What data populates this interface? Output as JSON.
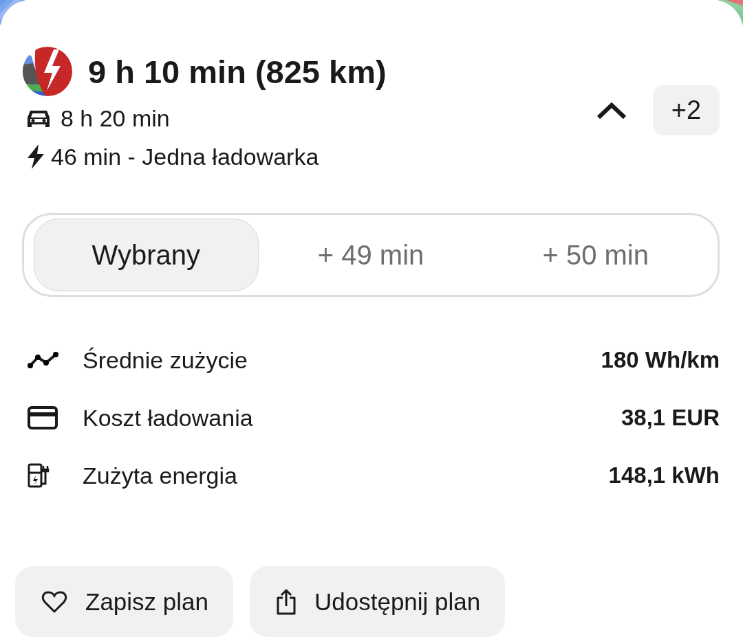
{
  "route": {
    "total": "9 h 10 min (825 km)",
    "drive_time": "8 h 20 min",
    "charging": "46 min - Jedna ładowarka",
    "expanded": true,
    "more_count": "+2"
  },
  "alternatives": [
    {
      "label": "Wybrany",
      "selected": true
    },
    {
      "label": "+ 49 min",
      "selected": false
    },
    {
      "label": "+ 50 min",
      "selected": false
    }
  ],
  "stats": [
    {
      "kind": "consumption",
      "label": "Średnie zużycie",
      "value": "180 Wh/km"
    },
    {
      "kind": "cost",
      "label": "Koszt ładowania",
      "value": "38,1 EUR"
    },
    {
      "kind": "energy",
      "label": "Zużyta energia",
      "value": "148,1 kWh"
    }
  ],
  "actions": [
    {
      "kind": "save",
      "label": "Zapisz plan"
    },
    {
      "kind": "share",
      "label": "Udostępnij plan"
    }
  ]
}
